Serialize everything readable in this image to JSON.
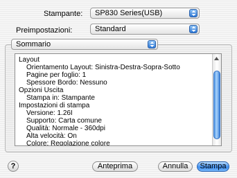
{
  "printer": {
    "label": "Stampante:",
    "value": "SP830 Series(USB)"
  },
  "presets": {
    "label": "Preimpostazioni:",
    "value": "Standard"
  },
  "section_popup": {
    "value": "Sommario"
  },
  "summary_lines": [
    "Layout",
    "Orientamento Layout:   Sinistra-Destra-Sopra-Sotto",
    "Pagine per foglio:   1",
    "Spessore Bordo:   Nessuno",
    "Opzioni Uscita",
    "Stampa in:   Stampante",
    "Impostazioni di stampa",
    "Versione:   1.26I",
    "Supporto:   Carta comune",
    "Qualità:   Normale - 360dpi",
    "Alta velocità:   On",
    "Colore:   Regolazione colore"
  ],
  "buttons": {
    "help": "?",
    "preview": "Anteprima",
    "cancel": "Annulla",
    "print": "Stampa"
  },
  "colors": {
    "accent": "#3f8ff0"
  }
}
